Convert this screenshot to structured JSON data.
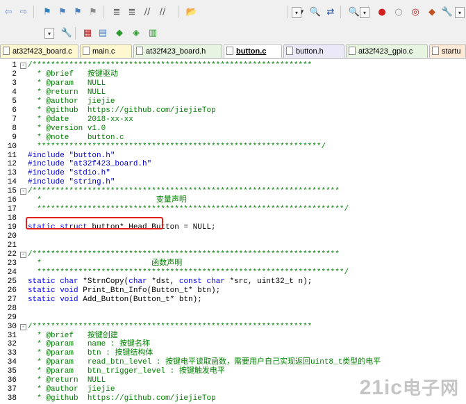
{
  "toolbar": {
    "row1": [
      {
        "name": "navigate-back-icon",
        "glyph": "⇦"
      },
      {
        "name": "navigate-forward-icon",
        "glyph": "⇨"
      },
      {
        "name": "insert-bookmark-icon",
        "glyph": "⚑"
      },
      {
        "name": "previous-bookmark-icon",
        "glyph": "⚑"
      },
      {
        "name": "next-bookmark-icon",
        "glyph": "⚑"
      },
      {
        "name": "clear-bookmarks-icon",
        "glyph": "⚑"
      },
      {
        "name": "indent-icon",
        "glyph": "≣"
      },
      {
        "name": "unindent-icon",
        "glyph": "≣"
      },
      {
        "name": "comment-icon",
        "glyph": "//"
      },
      {
        "name": "uncomment-icon",
        "glyph": "//"
      },
      {
        "name": "find-in-files-icon",
        "glyph": "📂"
      },
      {
        "name": "target-selector-icon",
        "glyph": "▾"
      },
      {
        "name": "find-icon",
        "glyph": "🔍"
      },
      {
        "name": "replace-icon",
        "glyph": "⇄"
      },
      {
        "name": "start-debug-icon",
        "glyph": "🔍"
      },
      {
        "name": "breakpoint-icon",
        "glyph": "●"
      },
      {
        "name": "disable-breakpoint-icon",
        "glyph": "○"
      },
      {
        "name": "kill-breakpoints-icon",
        "glyph": "◎"
      },
      {
        "name": "window-settings-icon",
        "glyph": "◆"
      },
      {
        "name": "configure-icon",
        "glyph": "🔧"
      }
    ],
    "row2": [
      {
        "name": "translate-icon",
        "glyph": "🔧"
      },
      {
        "name": "build-icon",
        "glyph": "▦"
      },
      {
        "name": "rebuild-icon",
        "glyph": "▤"
      },
      {
        "name": "batch-build-icon",
        "glyph": "◆"
      },
      {
        "name": "stop-build-icon",
        "glyph": "◈"
      },
      {
        "name": "download-icon",
        "glyph": "▥"
      }
    ]
  },
  "tabs": [
    {
      "label": "at32f423_board.c",
      "color": "t-yellow",
      "active": false
    },
    {
      "label": "main.c",
      "color": "t-yellow",
      "active": false
    },
    {
      "label": "at32f423_board.h",
      "color": "t-green",
      "active": false
    },
    {
      "label": "button.c",
      "color": "t-pink",
      "active": true
    },
    {
      "label": "button.h",
      "color": "t-blue",
      "active": false
    },
    {
      "label": "at32f423_gpio.c",
      "color": "t-green",
      "active": false
    },
    {
      "label": "startu",
      "color": "t-orange",
      "active": false
    }
  ],
  "code_lines": [
    {
      "n": "1",
      "fold": "-",
      "text": "/*************************************************************"
    },
    {
      "n": "2",
      "text": "  * @brief   按键驱动"
    },
    {
      "n": "3",
      "text": "  * @param   NULL"
    },
    {
      "n": "4",
      "text": "  * @return  NULL"
    },
    {
      "n": "5",
      "text": "  * @author  jiejie"
    },
    {
      "n": "6",
      "text": "  * @github  https://github.com/jiejieTop"
    },
    {
      "n": "7",
      "text": "  * @date    2018-xx-xx"
    },
    {
      "n": "8",
      "text": "  * @version v1.0"
    },
    {
      "n": "9",
      "text": "  * @note    button.c"
    },
    {
      "n": "10",
      "text": "  **************************************************************/"
    },
    {
      "n": "11",
      "kind": "cpp",
      "text": "#include \"button.h\""
    },
    {
      "n": "12",
      "kind": "cpp",
      "text": "#include \"at32f423_board.h\""
    },
    {
      "n": "13",
      "kind": "cpp",
      "text": "#include \"stdio.h\""
    },
    {
      "n": "14",
      "kind": "cpp",
      "text": "#include \"string.h\""
    },
    {
      "n": "15",
      "fold": "-",
      "text": "/*******************************************************************"
    },
    {
      "n": "16",
      "text": "  *                         变量声明"
    },
    {
      "n": "17",
      "text": "  *******************************************************************/"
    },
    {
      "n": "18",
      "text": ""
    },
    {
      "n": "19",
      "kind": "decl",
      "kw": "static struct ",
      "rest": "button* Head_Button = NULL;"
    },
    {
      "n": "20",
      "text": ""
    },
    {
      "n": "21",
      "text": ""
    },
    {
      "n": "22",
      "fold": "-",
      "text": "/*******************************************************************"
    },
    {
      "n": "23",
      "text": "  *                        函数声明"
    },
    {
      "n": "24",
      "text": "  *******************************************************************/"
    },
    {
      "n": "25",
      "kind": "mixed",
      "parts": [
        {
          "t": "kw",
          "v": "static char "
        },
        {
          "t": "tx",
          "v": "*StrnCopy("
        },
        {
          "t": "kw",
          "v": "char "
        },
        {
          "t": "tx",
          "v": "*dst, "
        },
        {
          "t": "kw",
          "v": "const char "
        },
        {
          "t": "tx",
          "v": "*src, uint32_t n);"
        }
      ]
    },
    {
      "n": "26",
      "kind": "mixed",
      "parts": [
        {
          "t": "kw",
          "v": "static void "
        },
        {
          "t": "tx",
          "v": "Print_Btn_Info(Button_t* btn);"
        }
      ]
    },
    {
      "n": "27",
      "kind": "mixed",
      "parts": [
        {
          "t": "kw",
          "v": "static void "
        },
        {
          "t": "tx",
          "v": "Add_Button(Button_t* btn);"
        }
      ]
    },
    {
      "n": "28",
      "text": ""
    },
    {
      "n": "29",
      "text": ""
    },
    {
      "n": "30",
      "fold": "-",
      "text": "/*************************************************************"
    },
    {
      "n": "31",
      "text": "  * @brief   按键创建"
    },
    {
      "n": "32",
      "text": "  * @param   name : 按键名称"
    },
    {
      "n": "33",
      "text": "  * @param   btn : 按键结构体"
    },
    {
      "n": "34",
      "text": "  * @param   read_btn_level : 按键电平读取函数，需要用户自己实现返回uint8_t类型的电平"
    },
    {
      "n": "35",
      "text": "  * @param   btn_trigger_level : 按键触发电平"
    },
    {
      "n": "36",
      "text": "  * @return  NULL"
    },
    {
      "n": "37",
      "text": "  * @author  jiejie"
    },
    {
      "n": "38",
      "text": "  * @github  https://github.com/jiejieTop"
    }
  ],
  "watermark": {
    "main": "21ic",
    "sub": "电子网"
  },
  "colors": {
    "comment": "#008000",
    "keyword": "#0000ff",
    "preprocessor": "#0000d0",
    "highlight_box": "#e0201a"
  }
}
